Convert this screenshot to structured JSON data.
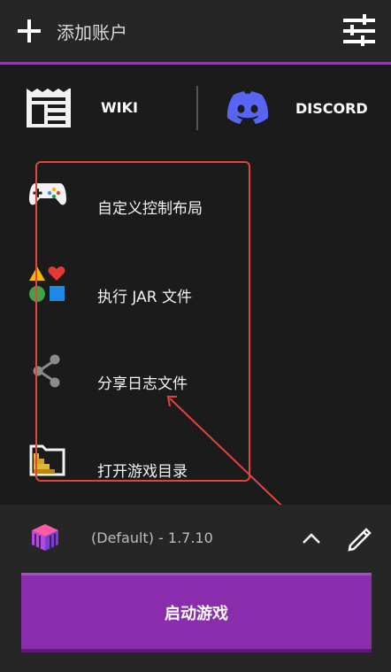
{
  "header": {
    "add_account_label": "添加账户",
    "add_icon": "plus-icon",
    "settings_icon": "sliders-icon"
  },
  "links": {
    "wiki_label": "WIKI",
    "discord_label": "DISCORD"
  },
  "menu": {
    "items": [
      {
        "label": "自定义控制布局",
        "icon": "gamepad-icon"
      },
      {
        "label": "执行 JAR 文件",
        "icon": "shapes-icon"
      },
      {
        "label": "分享日志文件",
        "icon": "share-icon"
      },
      {
        "label": "打开游戏目录",
        "icon": "folder-icon"
      }
    ]
  },
  "profile": {
    "label": "(Default) - 1.7.10",
    "expand_icon": "chevron-up-icon",
    "edit_icon": "pencil-icon"
  },
  "launch": {
    "label": "启动游戏"
  },
  "colors": {
    "accent": "#8a2dac",
    "annotation": "#e0463d",
    "discord": "#5865f2"
  }
}
